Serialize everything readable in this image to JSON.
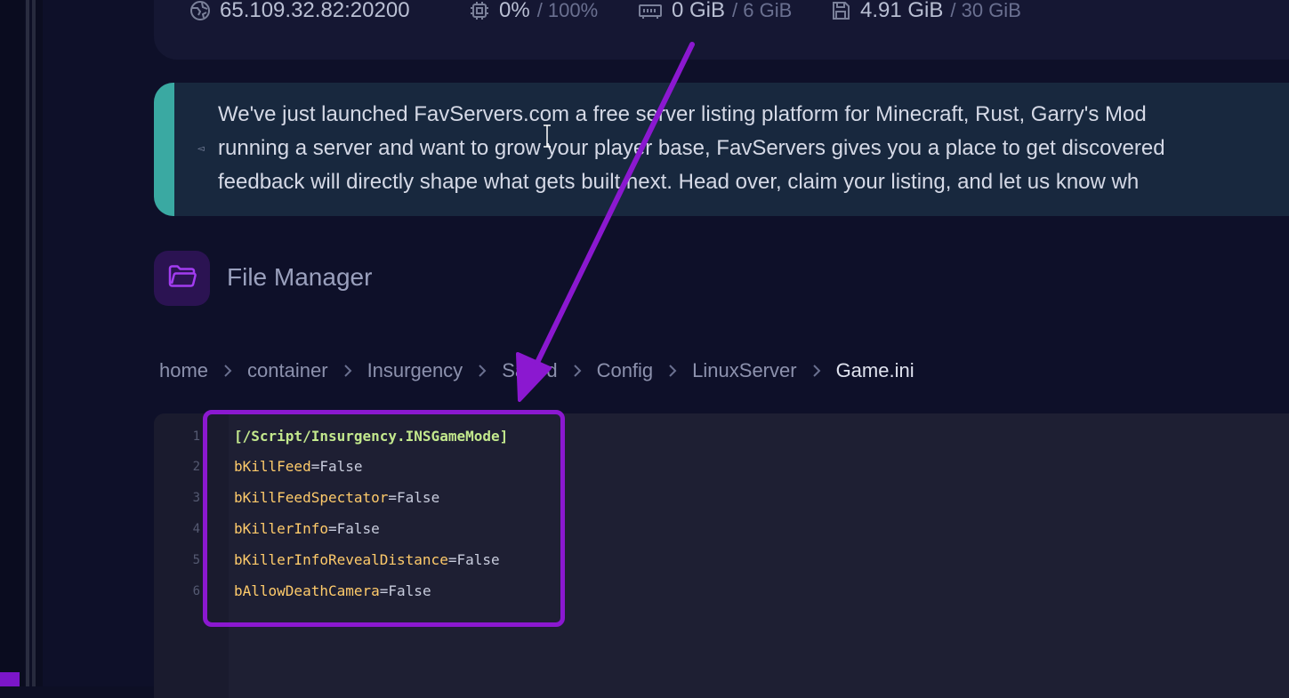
{
  "stats": {
    "address": "65.109.32.82:20200",
    "cpu": {
      "value": "0%",
      "max": "/ 100%"
    },
    "memory": {
      "value": "0 GiB",
      "max": "/ 6 GiB"
    },
    "disk": {
      "value": "4.91 GiB",
      "max": "/ 30 GiB"
    }
  },
  "notice": {
    "lines": [
      "We've just launched FavServers.com a free server listing platform for Minecraft, Rust, Garry's Mod",
      "running a server and want to grow your player base, FavServers gives you a place to get discovered",
      "feedback will directly shape what gets built next. Head over, claim your listing, and let us know wh"
    ]
  },
  "file_manager": {
    "title": "File Manager",
    "breadcrumb": [
      "home",
      "container",
      "Insurgency",
      "Saved",
      "Config",
      "LinuxServer",
      "Game.ini"
    ]
  },
  "editor": {
    "lines": [
      {
        "num": "1",
        "section": "[/Script/Insurgency.INSGameMode]"
      },
      {
        "num": "2",
        "key": "bKillFeed",
        "eq": "=",
        "value": "False"
      },
      {
        "num": "3",
        "key": "bKillFeedSpectator",
        "eq": "=",
        "value": "False"
      },
      {
        "num": "4",
        "key": "bKillerInfo",
        "eq": "=",
        "value": "False"
      },
      {
        "num": "5",
        "key": "bKillerInfoRevealDistance",
        "eq": "=",
        "value": "False"
      },
      {
        "num": "6",
        "key": "bAllowDeathCamera",
        "eq": "=",
        "value": "False"
      }
    ]
  },
  "colors": {
    "accent_teal": "#3aa9a2",
    "annotation_purple": "#8b18d0",
    "folder_purple": "#a23cf0"
  },
  "icons": [
    "network-icon",
    "cpu-icon",
    "memory-icon",
    "disk-icon",
    "megaphone-icon",
    "folder-icon",
    "chevron-right-icon"
  ]
}
